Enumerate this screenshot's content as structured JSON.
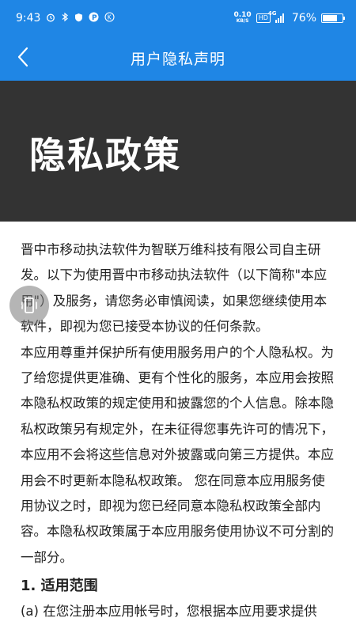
{
  "status_bar": {
    "time": "9:43",
    "net_speed_value": "0.10",
    "net_speed_unit": "KB/S",
    "hd_label": "HD",
    "signal_label": "4G",
    "battery_percent": "76%",
    "battery_level": 0.76
  },
  "header": {
    "title": "用户隐私声明"
  },
  "banner": {
    "title": "隐私政策"
  },
  "content": {
    "paragraph1": "晋中市移动执法软件为智联万维科技有限公司自主研发。以下为使用晋中市移动执法软件（以下简称\"本应用\"）及服务，请您务必审慎阅读，如果您继续使用本软件，即视为您已接受本协议的任何条款。",
    "paragraph2": "本应用尊重并保护所有使用服务用户的个人隐私权。为了给您提供更准确、更有个性化的服务，本应用会按照本隐私权政策的规定使用和披露您的个人信息。除本隐私权政策另有规定外，在未征得您事先许可的情况下，本应用不会将这些信息对外披露或向第三方提供。本应用会不时更新本隐私权政策。 您在同意本应用服务使用协议之时，即视为您已经同意本隐私权政策全部内容。本隐私权政策属于本应用服务使用协议不可分割的一部分。",
    "section1_heading": "1. 适用范围",
    "section1_partial": "(a) 在您注册本应用帐号时，您根据本应用要求提供"
  },
  "colors": {
    "primary": "#1f86e5",
    "banner_bg": "#333333",
    "text": "#222222"
  },
  "icons": {
    "back": "chevron-left-icon",
    "rotate": "screen-rotate-icon"
  }
}
